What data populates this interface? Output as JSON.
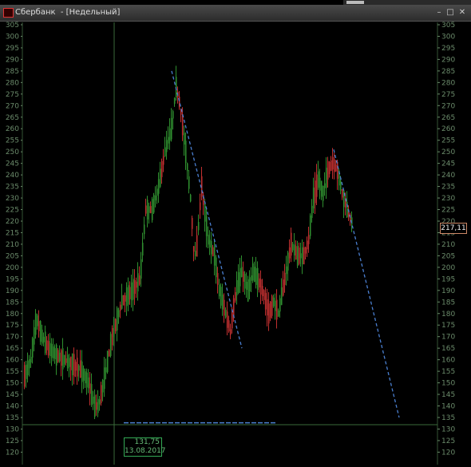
{
  "window": {
    "title": "Сбербанк  - [Недельный]",
    "buttons": {
      "minimize": "–",
      "maximize": "□",
      "close": "✕"
    }
  },
  "price_axis": {
    "labels": [
      "305",
      "300",
      "295",
      "290",
      "285",
      "280",
      "275",
      "270",
      "265",
      "260",
      "255",
      "250",
      "245",
      "240",
      "235",
      "230",
      "225",
      "220",
      "215",
      "210",
      "205",
      "200",
      "195",
      "190",
      "185",
      "180",
      "175",
      "170",
      "165",
      "160",
      "155",
      "150",
      "145",
      "140",
      "135",
      "130",
      "125",
      "120"
    ]
  },
  "current_price_tag": "217,11",
  "crosshair": {
    "price": "131,75",
    "date": "13.08.2017"
  },
  "colors": {
    "up_candle": "#2f8f2f",
    "down_candle": "#c03030",
    "trend_line": "#4a7fd0",
    "grid_text": "#6a8a6a",
    "axis_line": "#355535"
  }
}
